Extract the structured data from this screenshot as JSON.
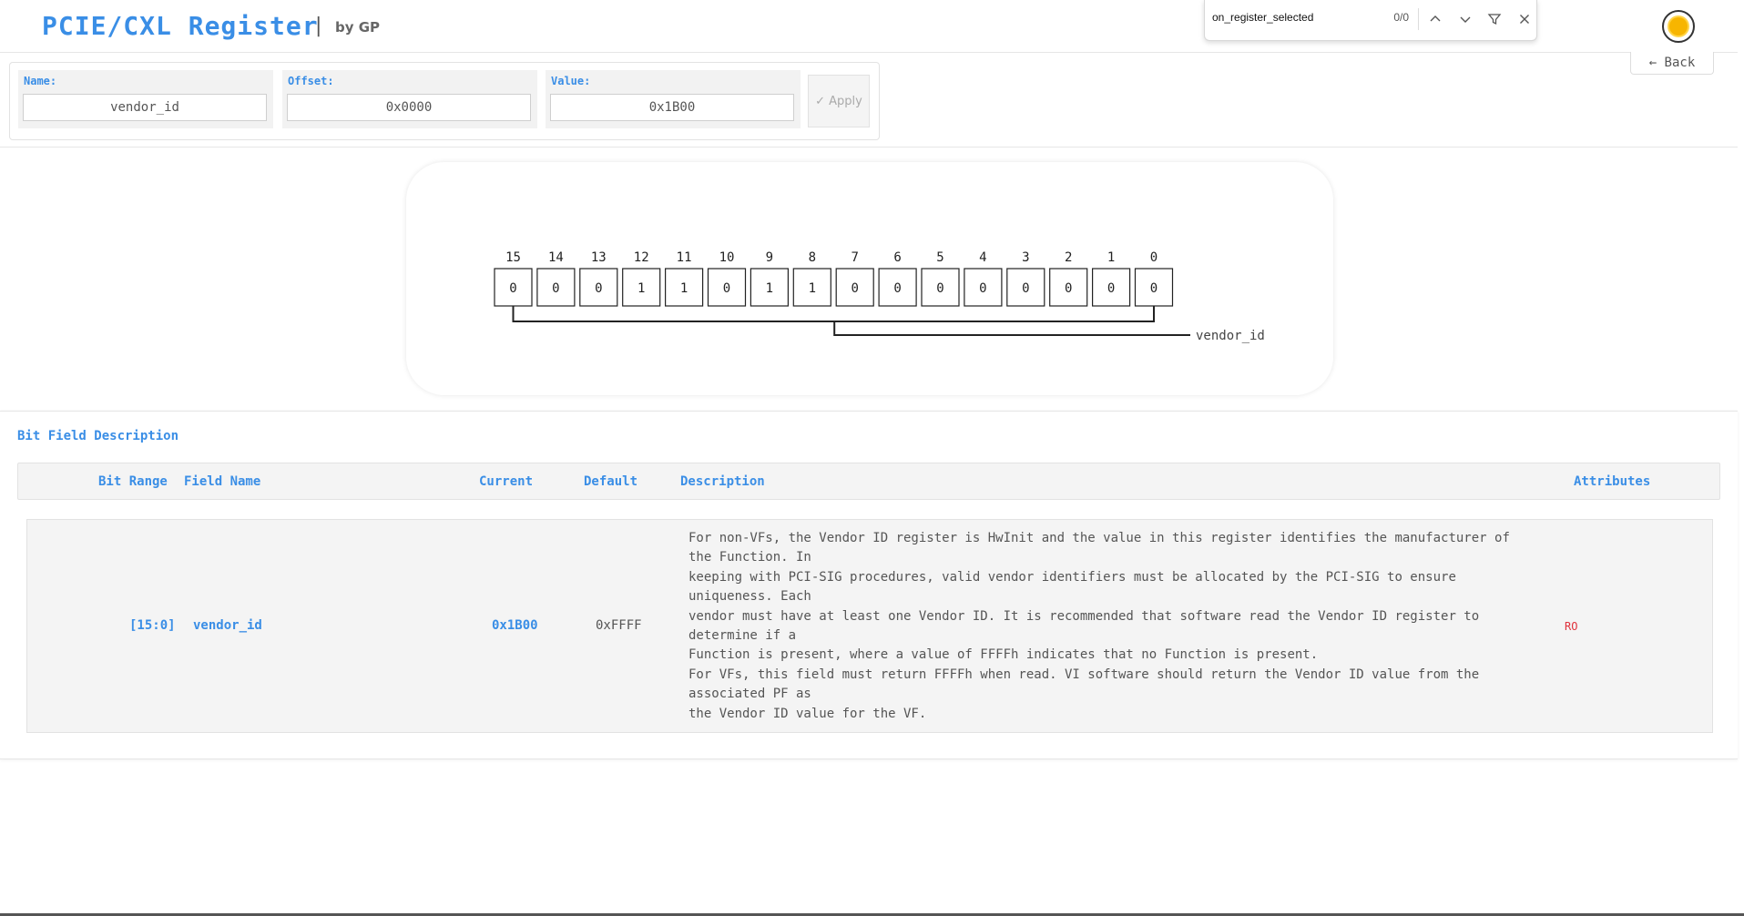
{
  "app": {
    "title": "PCIE/CXL Register",
    "separator": "|",
    "byline": "by GP"
  },
  "find_bar": {
    "query": "on_register_selected",
    "count": "0/0",
    "icons": [
      "chevron-up-icon",
      "chevron-down-icon",
      "filter-icon",
      "close-icon"
    ]
  },
  "nav": {
    "back_label": "← Back"
  },
  "form": {
    "name_label": "Name:",
    "name_value": "vendor_id",
    "offset_label": "Offset:",
    "offset_value": "0x0000",
    "value_label": "Value:",
    "value_value": "0x1B00",
    "apply_label": "✓ Apply"
  },
  "register": {
    "bit_numbers": [
      "15",
      "14",
      "13",
      "12",
      "11",
      "10",
      "9",
      "8",
      "7",
      "6",
      "5",
      "4",
      "3",
      "2",
      "1",
      "0"
    ],
    "bit_values": [
      "0",
      "0",
      "0",
      "1",
      "1",
      "0",
      "1",
      "1",
      "0",
      "0",
      "0",
      "0",
      "0",
      "0",
      "0",
      "0"
    ],
    "field_label": "vendor_id"
  },
  "bit_fields": {
    "section_title": "Bit Field Description",
    "headers": {
      "bit_range": "Bit Range",
      "field_name": "Field Name",
      "current": "Current",
      "default": "Default",
      "description": "Description",
      "attributes": "Attributes"
    },
    "rows": [
      {
        "bit_range": "[15:0]",
        "field_name": "vendor_id",
        "current": "0x1B00",
        "default": "0xFFFF",
        "attributes": "RO",
        "description_lines": [
          "For non-VFs, the Vendor ID register is HwInit and the value in this register identifies the manufacturer of the Function. In",
          "keeping with PCI-SIG procedures, valid vendor identifiers must be allocated by the PCI-SIG to ensure uniqueness. Each",
          "vendor must have at least one Vendor ID. It is recommended that software read the Vendor ID register to determine if a",
          "Function is present, where a value of FFFFh indicates that no Function is present.",
          "For VFs, this field must return FFFFh when read. VI software should return the Vendor ID value from the associated PF as",
          "the Vendor ID value for the VF."
        ]
      }
    ]
  },
  "colors": {
    "accent": "#3a8ee6",
    "attribute": "#e0323c",
    "panel_bg": "#f4f4f4"
  }
}
